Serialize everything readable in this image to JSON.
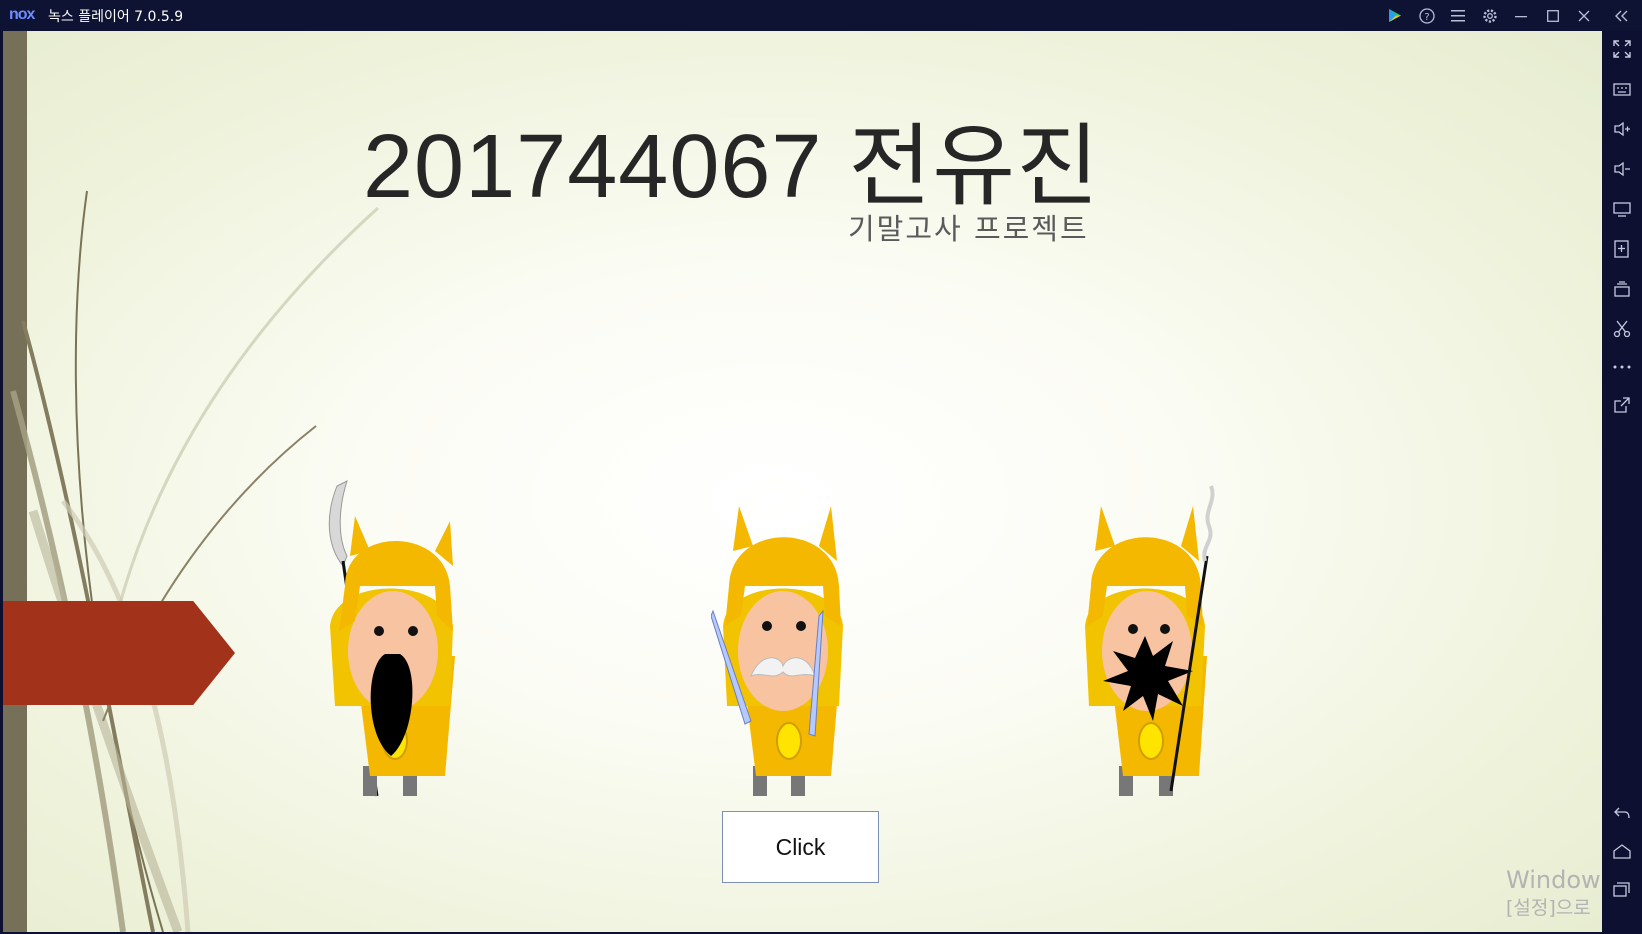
{
  "titlebar": {
    "logo": "nox",
    "app_title": "녹스 플레이어 7.0.5.9",
    "icons": [
      "play-store-icon",
      "help-icon",
      "menu-icon",
      "settings-icon",
      "minimize-icon",
      "maximize-icon",
      "close-icon",
      "collapse-sidebar-icon"
    ]
  },
  "slide": {
    "title": "201744067 전유진",
    "subtitle": "기말고사 프로젝트",
    "button_label": "Click",
    "characters": [
      "general-black-beard",
      "general-white-mustache",
      "general-spiky-beard"
    ]
  },
  "watermark": {
    "line1": "Window",
    "line2": "[설정]으로"
  },
  "sidebar": {
    "icons": [
      "fullscreen-icon",
      "keyboard-icon",
      "volume-up-icon",
      "volume-down-icon",
      "screen-icon",
      "add-apk-icon",
      "multi-instance-icon",
      "screenshot-icon",
      "more-icon",
      "share-icon",
      "back-icon",
      "home-icon",
      "recent-apps-icon"
    ]
  },
  "colors": {
    "frame": "#0e1233",
    "accent_arrow": "#a2331a",
    "left_bar": "#777058",
    "helmet": "#f5b800"
  }
}
